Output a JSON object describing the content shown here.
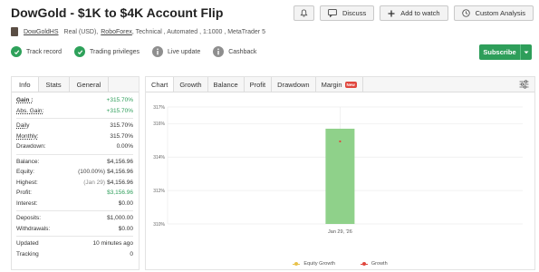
{
  "page": {
    "title": "DowGold - $1K to $4K Account Flip"
  },
  "header_buttons": {
    "discuss": "Discuss",
    "add_to_watch": "Add to watch",
    "custom_analysis": "Custom Analysis"
  },
  "account": {
    "owner": "DowGoldHS",
    "type": "Real (USD),",
    "broker": "RoboForex",
    "details": ", Technical , Automated , 1:1000 , MetaTrader 5"
  },
  "features": [
    {
      "label": "Track record",
      "status": "verified"
    },
    {
      "label": "Trading privileges",
      "status": "verified"
    },
    {
      "label": "Live update",
      "status": "info"
    },
    {
      "label": "Cashback",
      "status": "info"
    }
  ],
  "subscribe_label": "Subscribe",
  "left_tabs": [
    "Info",
    "Stats",
    "General"
  ],
  "stats_group1": [
    {
      "label": "Gain :",
      "value": "+315.70%"
    },
    {
      "label": "Abs. Gain:",
      "value": "+315.70%"
    }
  ],
  "stats_group2": [
    {
      "label": "Daily",
      "value": "315.70%"
    },
    {
      "label": "Monthly:",
      "value": "315.70%"
    },
    {
      "label": "Drawdown:",
      "value": "0.00%"
    }
  ],
  "stats_group3": [
    {
      "label": "Balance:",
      "value": "$4,156.96"
    },
    {
      "label": "Equity:",
      "prefix": "(100.00%)",
      "value": "$4,156.96"
    },
    {
      "label": "Highest:",
      "prefix": "(Jan 29)",
      "value": "$4,156.96"
    },
    {
      "label": "Profit:",
      "value": "$3,156.96"
    },
    {
      "label": "Interest:",
      "value": "$0.00"
    }
  ],
  "stats_group4": [
    {
      "label": "Deposits:",
      "value": "$1,000.00"
    },
    {
      "label": "Withdrawals:",
      "value": "$0.00"
    }
  ],
  "stats_group5": [
    {
      "label": "Updated",
      "value": "10 minutes ago"
    },
    {
      "label": "Tracking",
      "value": "0"
    }
  ],
  "chart_tabs": {
    "chart": "Chart",
    "growth": "Growth",
    "balance": "Balance",
    "profit": "Profit",
    "drawdown": "Drawdown",
    "margin": "Margin",
    "new_badge": "New"
  },
  "colors": {
    "accent_green": "#2e9e5a",
    "bar_green": "#8fd18a",
    "growth_red": "#e0463d",
    "equity_yellow": "#e8c24a"
  },
  "chart_data": {
    "type": "bar",
    "categories": [
      "Jan 29, '26"
    ],
    "ylim": [
      310,
      317
    ],
    "yticks": [
      310,
      312,
      314,
      316,
      317
    ],
    "ytick_labels": [
      "310%",
      "312%",
      "314%",
      "316%",
      "317%"
    ],
    "series": [
      {
        "name": "Equity Growth",
        "type": "bar",
        "values": [
          315.7
        ]
      },
      {
        "name": "Growth",
        "type": "scatter",
        "values": [
          315.7
        ]
      }
    ],
    "grid": true,
    "legend": "bottom-center"
  }
}
